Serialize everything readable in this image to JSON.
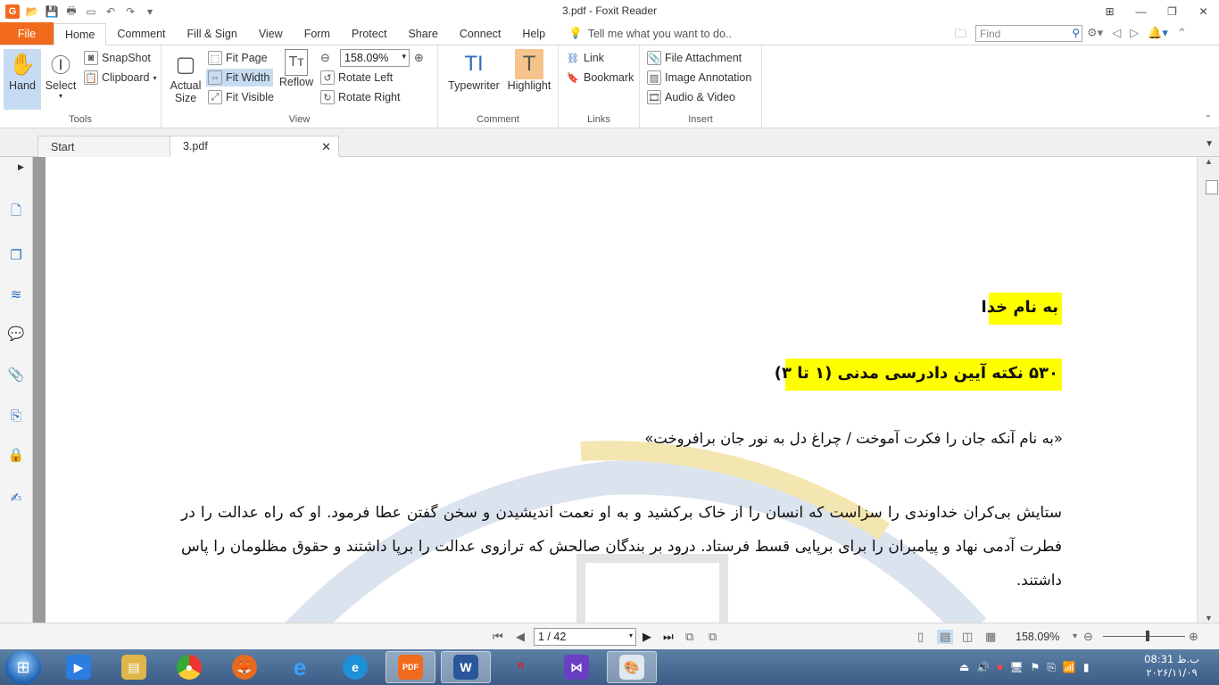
{
  "window": {
    "title": "3.pdf - Foxit Reader",
    "minimize": "—",
    "restore": "❐",
    "close": "✕"
  },
  "ribbon_tabs": {
    "file": "File",
    "home": "Home",
    "comment": "Comment",
    "fill_sign": "Fill & Sign",
    "view": "View",
    "form": "Form",
    "protect": "Protect",
    "share": "Share",
    "connect": "Connect",
    "help": "Help",
    "tell_me": "Tell me what you want to do.."
  },
  "find": {
    "placeholder": "Find"
  },
  "ribbon": {
    "tools": {
      "label": "Tools",
      "hand": "Hand",
      "select": "Select",
      "snapshot": "SnapShot",
      "clipboard": "Clipboard"
    },
    "view": {
      "label": "View",
      "actual_size_1": "Actual",
      "actual_size_2": "Size",
      "fit_page": "Fit Page",
      "fit_width": "Fit Width",
      "fit_visible": "Fit Visible",
      "reflow": "Reflow",
      "zoom_value": "158.09%",
      "rotate_left": "Rotate Left",
      "rotate_right": "Rotate Right"
    },
    "comment": {
      "label": "Comment",
      "typewriter": "Typewriter",
      "highlight": "Highlight"
    },
    "links": {
      "label": "Links",
      "link": "Link",
      "bookmark": "Bookmark"
    },
    "insert": {
      "label": "Insert",
      "file_attachment": "File Attachment",
      "image_annotation": "Image Annotation",
      "audio_video": "Audio & Video"
    }
  },
  "doc_tabs": {
    "start": "Start",
    "current": "3.pdf"
  },
  "document": {
    "heading1": "به نام خدا",
    "heading2": "۵۳۰ نکته آیین دادرسی مدنی (۱ تا ۳)",
    "quote": "«به نام آنکه جان را فکرت آموخت / چراغ دل به نور جان برافروخت»",
    "paragraph": "ستایش بی‌کران خداوندی را سزاست که انسان را از خاک برکشید و به او نعمت اندیشیدن و سخن گفتن عطا فرمود. او که راه عدالت را در فطرت آدمی نهاد و پیامبران را برای برپایی قسط فرستاد. درود بر بندگان صالحش که ترازوی عدالت را برپا داشتند و حقوق مظلومان را پاس داشتند."
  },
  "statusbar": {
    "page_indicator": "1 / 42",
    "zoom": "158.09%"
  },
  "taskbar": {
    "foxit_label": "PDF",
    "word_label": "W",
    "clock_time": "08:31 ب.ظ",
    "clock_date": "۲۰۲۶/۱۱/۰۹"
  },
  "colors": {
    "file_tab": "#f26b1d",
    "highlight_yellow": "#ffff00",
    "selected_button": "#c7dcf2",
    "highlight_button": "#f6c48a",
    "taskbar": "#4a6d96"
  }
}
